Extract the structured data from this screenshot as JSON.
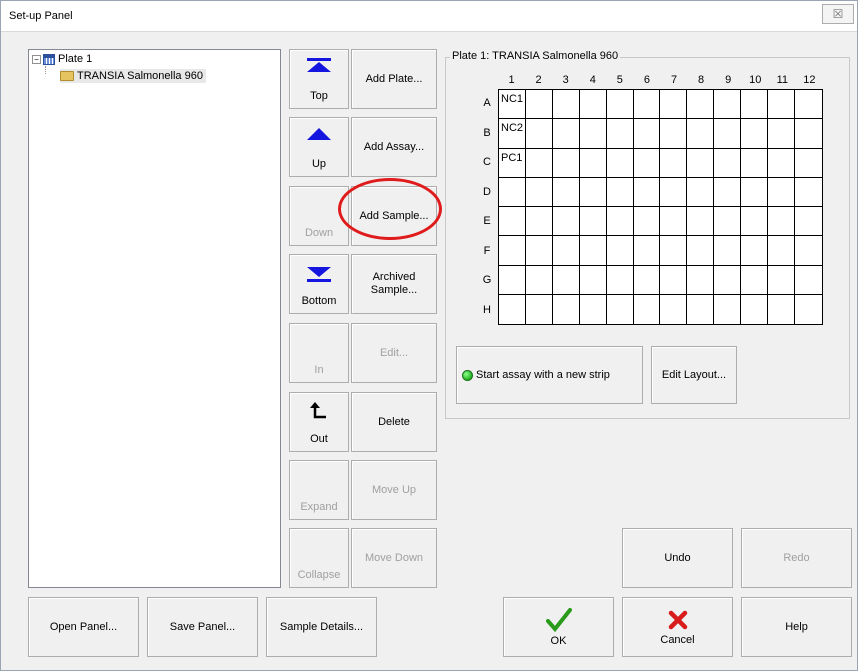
{
  "window": {
    "title": "Set-up Panel",
    "close_glyph": "☒"
  },
  "tree": {
    "root_label": "Plate 1",
    "root_expander": "−",
    "child_label": "TRANSIA Salmonella 960"
  },
  "nav_buttons": {
    "top": "Top",
    "up": "Up",
    "down": "Down",
    "bottom": "Bottom",
    "in": "In",
    "out": "Out",
    "expand": "Expand",
    "collapse": "Collapse"
  },
  "action_buttons": {
    "add_plate": "Add Plate...",
    "add_assay": "Add Assay...",
    "add_sample": "Add Sample...",
    "archived_sample_line1": "Archived",
    "archived_sample_line2": "Sample...",
    "edit": "Edit...",
    "delete": "Delete",
    "move_up": "Move Up",
    "move_down": "Move Down"
  },
  "plate": {
    "group_title": "Plate 1: TRANSIA Salmonella 960",
    "columns": [
      "1",
      "2",
      "3",
      "4",
      "5",
      "6",
      "7",
      "8",
      "9",
      "10",
      "11",
      "12"
    ],
    "rows": [
      "A",
      "B",
      "C",
      "D",
      "E",
      "F",
      "G",
      "H"
    ],
    "filled_cells": {
      "A1": "NC1",
      "B1": "NC2",
      "C1": "PC1"
    },
    "start_assay_label": "Start assay with a new strip",
    "edit_layout_label": "Edit Layout..."
  },
  "bottom_buttons": {
    "undo": "Undo",
    "redo": "Redo",
    "open_panel": "Open Panel...",
    "save_panel": "Save Panel...",
    "sample_details": "Sample Details...",
    "ok": "OK",
    "cancel": "Cancel",
    "help": "Help"
  },
  "colors": {
    "accent_blue": "#1515e0",
    "ok_green": "#2a9a1a",
    "cancel_red": "#d81c1c",
    "highlight_red": "#e01b1b",
    "status_green": "#1fb21f"
  }
}
